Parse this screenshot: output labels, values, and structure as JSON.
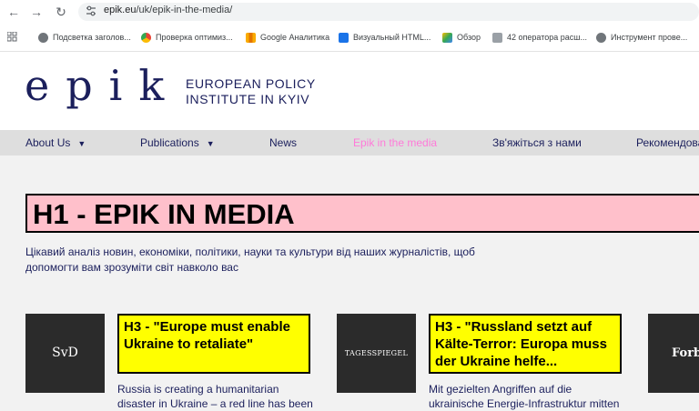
{
  "browser": {
    "url_host": "epik.eu",
    "url_path": "/uk/epik-in-the-media/",
    "bookmarks": [
      {
        "label": "Подсветка заголов...",
        "icon": "globe-icon"
      },
      {
        "label": "Проверка оптимиз...",
        "icon": "chrome-icon"
      },
      {
        "label": "Google Аналитика",
        "icon": "analytics-icon"
      },
      {
        "label": "Визуальный HTML...",
        "icon": "html-editor-icon"
      },
      {
        "label": "Обзор",
        "icon": "search-console-icon"
      },
      {
        "label": "42 оператора расш...",
        "icon": "bookmark-page-icon"
      },
      {
        "label": "Инструмент прове...",
        "icon": "globe-icon"
      }
    ]
  },
  "site": {
    "logo": "epik",
    "tagline_line1": "EUROPEAN POLICY",
    "tagline_line2": "INSTITUTE IN KYIV",
    "brand_color": "#1b1f5c",
    "active_color": "#ff7ad9"
  },
  "menu": [
    {
      "label": "About Us",
      "dropdown": true
    },
    {
      "label": "Publications",
      "dropdown": true
    },
    {
      "label": "News",
      "dropdown": false
    },
    {
      "label": "Epik in the media",
      "dropdown": false,
      "active": true
    },
    {
      "label": "Зв'яжіться з нами",
      "dropdown": false
    },
    {
      "label": "Рекомендовані",
      "dropdown": false
    }
  ],
  "main": {
    "h1": "H1 - EPIK IN MEDIA",
    "intro": "Цікавий аналіз новин, економіки, політики, науки та культури від наших журналістів, щоб допомогти вам зрозуміти світ навколо вас",
    "cards": [
      {
        "source_logo": "SvD",
        "title": "H3 - \"Europe must enable Ukraine to retaliate\"",
        "excerpt": "Russia is creating a humanitarian disaster in Ukraine – a red line has been"
      },
      {
        "source_logo": "TAGESSPIEGEL",
        "title": "H3 - \"Russland setzt auf Kälte-Terror: Europa muss der Ukraine helfe...",
        "excerpt": "Mit gezielten Angriffen auf die ukrainische Energie-Infrastruktur mitten"
      },
      {
        "source_logo": "Forbes",
        "title": "",
        "excerpt": ""
      }
    ],
    "h1_bg": "#ffc0cb",
    "h3_bg": "#ffff00"
  }
}
